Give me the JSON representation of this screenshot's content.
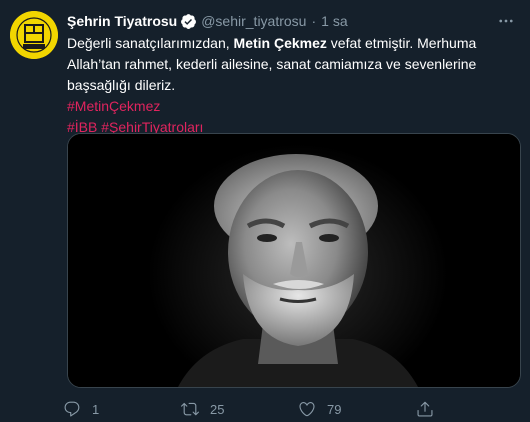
{
  "tweet": {
    "author": {
      "display_name": "Şehrin Tiyatrosu",
      "handle": "@sehir_tiyatrosu",
      "separator": "·",
      "time": "1 sa",
      "verified_icon": "verified-badge-icon",
      "avatar_icon": "istanbul-sehir-tiyatrolari-logo"
    },
    "text": {
      "part1": "Değerli sanatçılarımızdan, ",
      "bold": "Metin Çekmez",
      "part2": " vefat etmiştir. Merhuma Allah’tan rahmet, kederli ailesine, sanat camiamıza ve sevenlerine başsağlığı dileriz."
    },
    "hashtags": {
      "line1": "#MetinÇekmez",
      "line2_a": "#İBB",
      "line2_b": "#ŞehirTiyatroları"
    },
    "media": {
      "icon": "black-and-white-portrait-photo"
    },
    "actions": {
      "reply": {
        "icon": "reply-icon",
        "count": "1"
      },
      "retweet": {
        "icon": "retweet-icon",
        "count": "25"
      },
      "like": {
        "icon": "heart-icon",
        "count": "79"
      },
      "share": {
        "icon": "share-icon"
      }
    },
    "more_icon": "more-icon"
  },
  "colors": {
    "background": "#15202b",
    "secondary_text": "#8899a6",
    "hashtag": "#e0245e",
    "verified": "#ffffff",
    "avatar_bg": "#f2d600"
  }
}
